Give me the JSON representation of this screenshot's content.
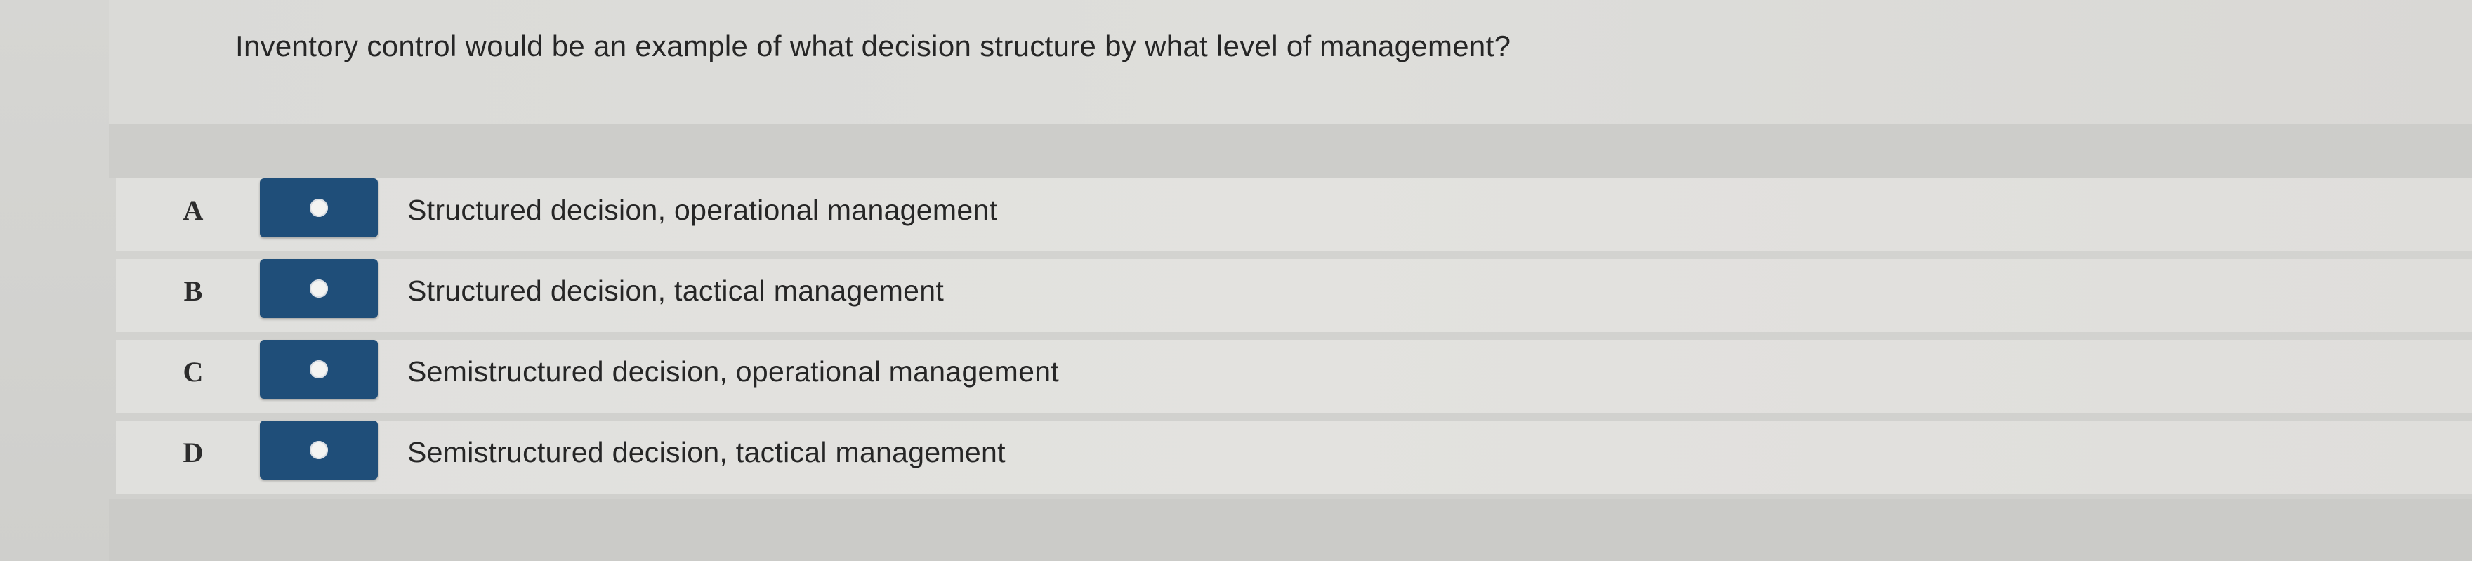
{
  "question": {
    "text": "Inventory control would be an example of what decision structure by what level of management?"
  },
  "options": [
    {
      "letter": "A",
      "label": "Structured decision, operational management"
    },
    {
      "letter": "B",
      "label": "Structured decision, tactical management"
    },
    {
      "letter": "C",
      "label": "Semistructured decision, operational management"
    },
    {
      "letter": "D",
      "label": "Semistructured decision, tactical management"
    }
  ],
  "colors": {
    "radio_box": "#1f4e79",
    "radio_dot": "#f4f4f2"
  }
}
